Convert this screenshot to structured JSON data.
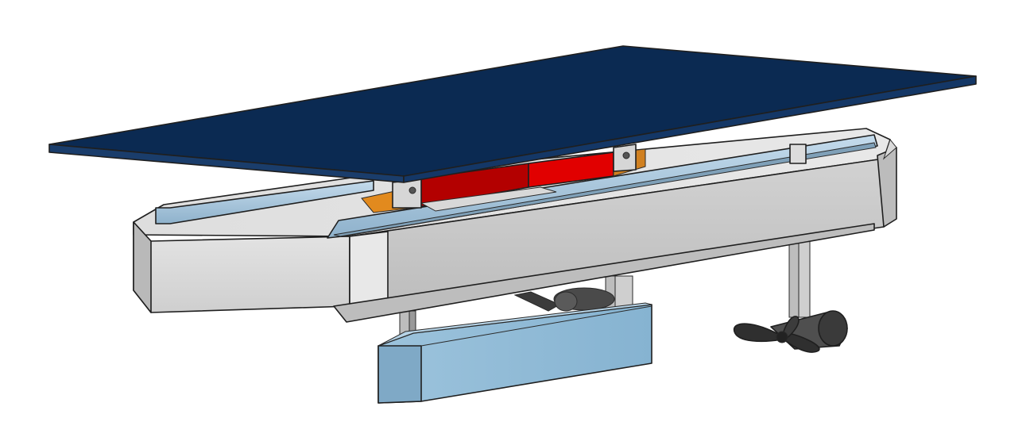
{
  "colors": {
    "background": "#ffffff",
    "solar_panel_top": "#0b2a52",
    "solar_panel_edge": "#1a3d6b",
    "hull_light": "#d9d9d9",
    "hull_mid": "#c8c8c8",
    "hull_dark": "#b4b4b4",
    "rail": "#a9c6dd",
    "battery_red": "#e10000",
    "battery_dark_red": "#a30000",
    "orange_tray": "#e28a1e",
    "keel_light": "#8fbad6",
    "keel_dark": "#6f9ab8",
    "strut": "#b9b9b9",
    "propeller": "#3a3a3a",
    "outline": "#1f1f1f"
  },
  "parts": {
    "solar_panel": "solar-panel",
    "hull": "hull",
    "rails": "side-rails",
    "battery": "battery-pack",
    "keel": "keel-float",
    "struts": "support-struts",
    "propeller": "propeller",
    "motor": "motor-pod"
  }
}
